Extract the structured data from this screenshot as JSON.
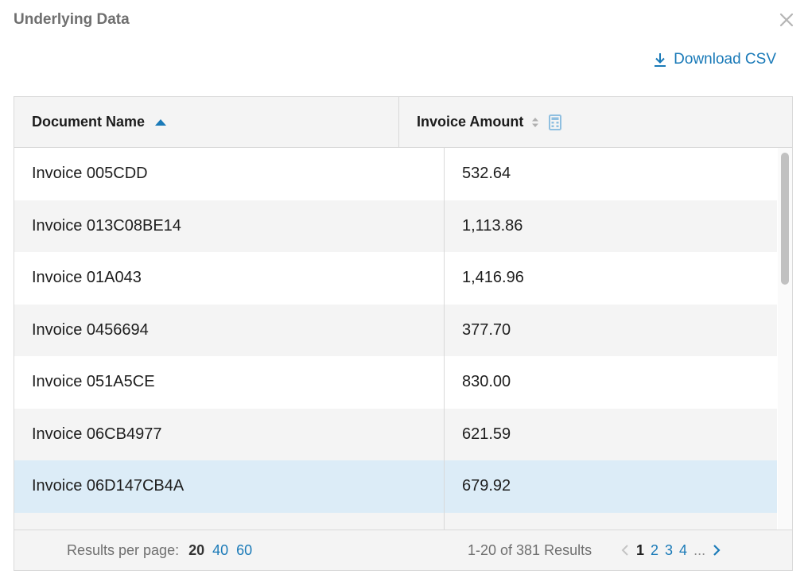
{
  "dialog": {
    "title": "Underlying Data",
    "close_icon": "close-icon"
  },
  "toolbar": {
    "download_label": "Download CSV",
    "download_icon": "download-icon"
  },
  "table": {
    "columns": [
      {
        "label": "Document Name",
        "sort": "ascending",
        "icon": "sort-ascending-icon"
      },
      {
        "label": "Invoice Amount",
        "sort": "none",
        "icon": "sort-both-icon",
        "extra_icon": "calculator-icon"
      }
    ],
    "rows": [
      {
        "document": "Invoice 005CDD",
        "amount": "532.64"
      },
      {
        "document": "Invoice 013C08BE14",
        "amount": "1,113.86"
      },
      {
        "document": "Invoice 01A043",
        "amount": "1,416.96"
      },
      {
        "document": "Invoice 0456694",
        "amount": "377.70"
      },
      {
        "document": "Invoice 051A5CE",
        "amount": "830.00"
      },
      {
        "document": "Invoice 06CB4977",
        "amount": "621.59"
      },
      {
        "document": "Invoice 06D147CB4A",
        "amount": "679.92",
        "highlighted": true
      }
    ]
  },
  "footer": {
    "results_per_page_label": "Results per page:",
    "page_size_options": [
      "20",
      "40",
      "60"
    ],
    "selected_page_size": "20",
    "summary": "1-20 of 381 Results",
    "pages": [
      "1",
      "2",
      "3",
      "4"
    ],
    "current_page": "1",
    "ellipsis": "..."
  },
  "colors": {
    "accent": "#1a7ab8",
    "highlight_row": "#dcecf7",
    "alt_row": "#f4f4f4",
    "border": "#d9d9d9"
  }
}
